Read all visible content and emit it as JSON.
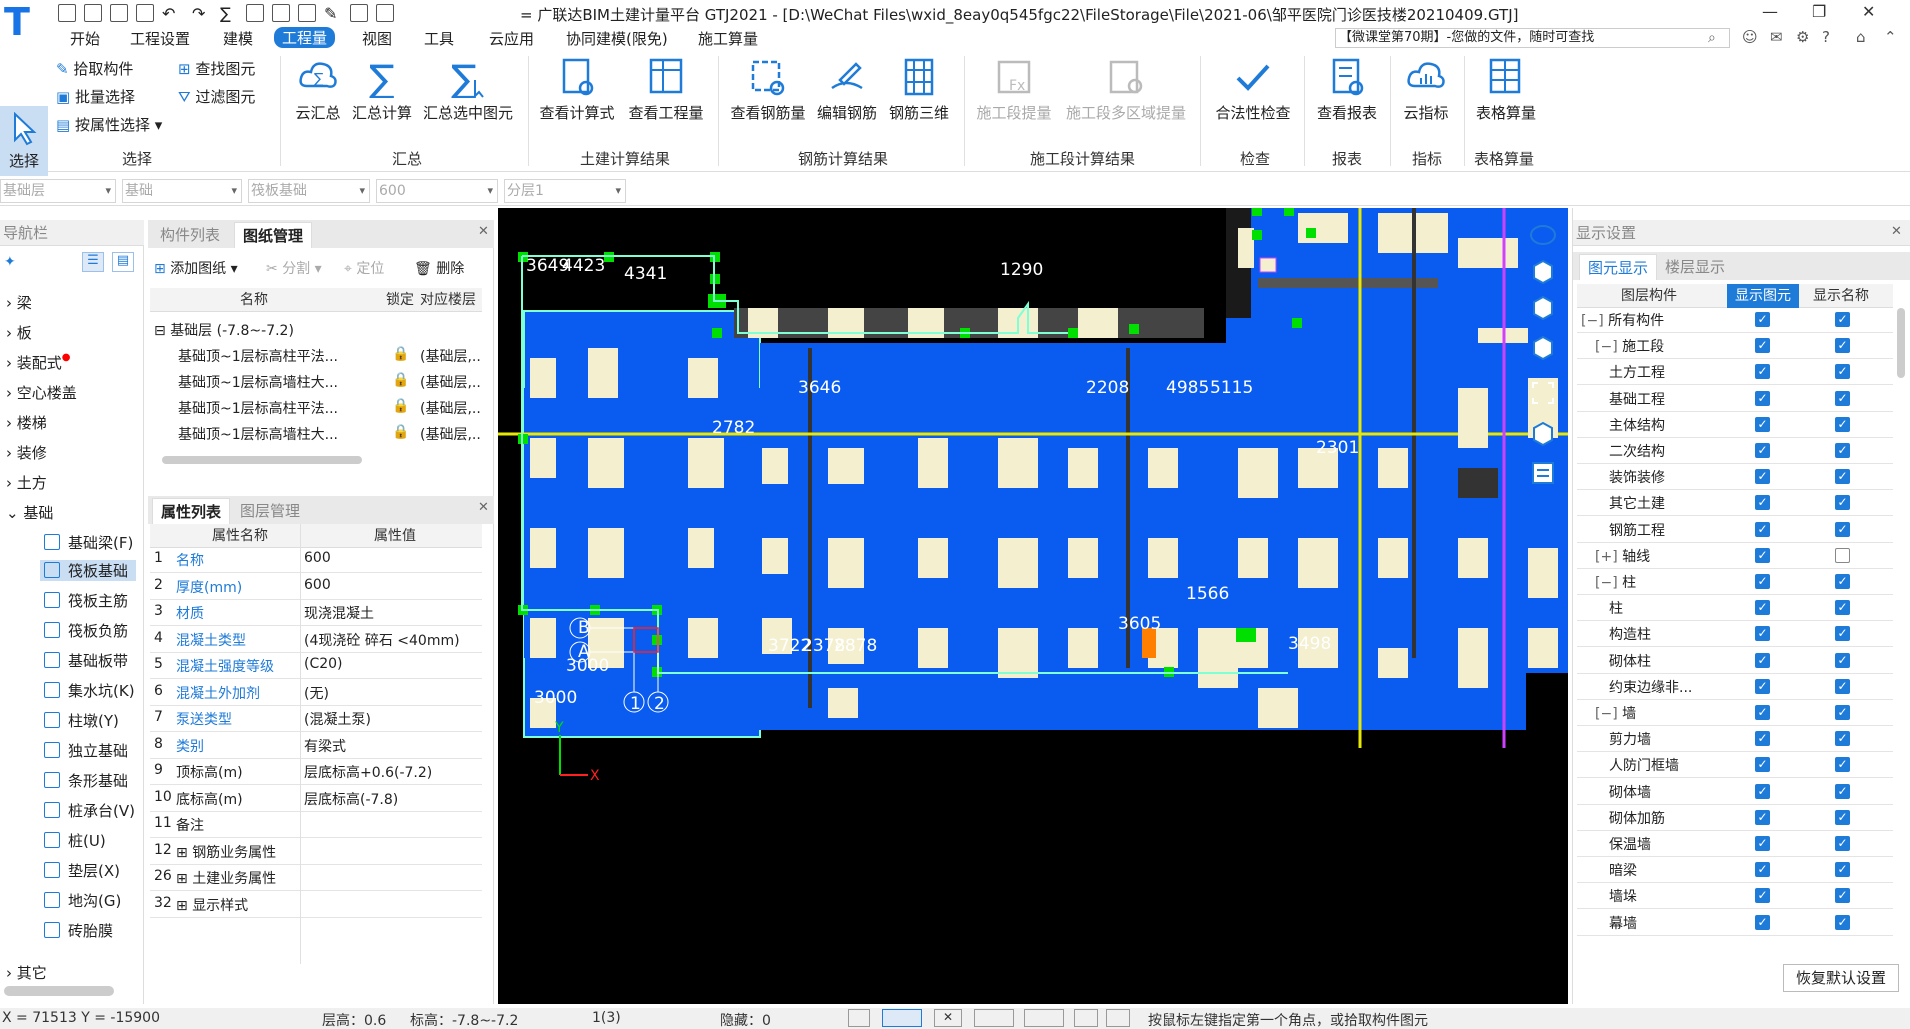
{
  "app": {
    "title": "= 广联达BIM土建计量平台 GTJ2021 - [D:\\WeChat Files\\wxid_8eay0q545fgc22\\FileStorage\\File\\2021-06\\邹平医院门诊医技楼20210409.GTJ]",
    "logo": "T"
  },
  "menu": [
    "开始",
    "工程设置",
    "建模",
    "工程量",
    "视图",
    "工具",
    "云应用",
    "协同建模(限免)",
    "施工算量"
  ],
  "menu_active": "工程量",
  "notice": "【微课堂第70期】-您做的文件，随时可查找",
  "ribbon": {
    "select": {
      "label": "选择",
      "items": [
        "拾取构件",
        "批量选择",
        "按属性选择",
        "查找图元",
        "过滤图元"
      ],
      "group": "选择"
    },
    "summary": {
      "items": [
        "云汇总",
        "汇总计算",
        "汇总选中图元"
      ],
      "group": "汇总"
    },
    "civil": {
      "items": [
        "查看计算式",
        "查看工程量"
      ],
      "group": "土建计算结果"
    },
    "rebar": {
      "items": [
        "查看钢筋量",
        "编辑钢筋",
        "钢筋三维"
      ],
      "group": "钢筋计算结果"
    },
    "stage": {
      "items": [
        "施工段提量",
        "施工段多区域提量"
      ],
      "group": "施工段计算结果"
    },
    "check": {
      "items": [
        "合法性检查"
      ],
      "group": "检查"
    },
    "report": {
      "items": [
        "查看报表"
      ],
      "group": "报表"
    },
    "index": {
      "items": [
        "云指标"
      ],
      "group": "指标"
    },
    "table": {
      "items": [
        "表格算量"
      ],
      "group": "表格算量"
    }
  },
  "filters": [
    "基础层",
    "基础",
    "筏板基础",
    "600",
    "分层1"
  ],
  "nav": {
    "title": "导航栏",
    "items": [
      "梁",
      "板",
      "装配式",
      "空心楼盖",
      "楼梯",
      "装修",
      "土方",
      "基础"
    ],
    "sub": [
      "基础梁(F)",
      "筏板基础",
      "筏板主筋",
      "筏板负筋",
      "基础板带",
      "集水坑(K)",
      "柱墩(Y)",
      "独立基础",
      "条形基础",
      "桩承台(V)",
      "桩(U)",
      "垫层(X)",
      "地沟(G)",
      "砖胎膜"
    ],
    "last": "其它"
  },
  "drawing_panel": {
    "tabs": [
      "构件列表",
      "图纸管理"
    ],
    "actions": [
      "添加图纸",
      "分割",
      "定位",
      "删除"
    ],
    "headers": [
      "名称",
      "锁定",
      "对应楼层"
    ],
    "group": "基础层 (-7.8~-7.2)",
    "rows": [
      {
        "name": "基础顶~1层标高柱平法...",
        "floor": "(基础层,..."
      },
      {
        "name": "基础顶~1层标高墙柱大...",
        "floor": "(基础层,..."
      },
      {
        "name": "基础顶~1层标高柱平法...",
        "floor": "(基础层,..."
      },
      {
        "name": "基础顶~1层标高墙柱大...",
        "floor": "(基础层,..."
      }
    ]
  },
  "prop_panel": {
    "tabs": [
      "属性列表",
      "图层管理"
    ],
    "headers": [
      "属性名称",
      "属性值"
    ],
    "rows": [
      {
        "n": "1",
        "name": "名称",
        "value": "600",
        "blue": true
      },
      {
        "n": "2",
        "name": "厚度(mm)",
        "value": "600",
        "blue": true
      },
      {
        "n": "3",
        "name": "材质",
        "value": "现浇混凝土",
        "blue": true
      },
      {
        "n": "4",
        "name": "混凝土类型",
        "value": "(4现浇砼 碎石 <40mm)",
        "blue": true
      },
      {
        "n": "5",
        "name": "混凝土强度等级",
        "value": "(C20)",
        "blue": true
      },
      {
        "n": "6",
        "name": "混凝土外加剂",
        "value": "(无)",
        "blue": true
      },
      {
        "n": "7",
        "name": "泵送类型",
        "value": "(混凝土泵)",
        "blue": true
      },
      {
        "n": "8",
        "name": "类别",
        "value": "有梁式",
        "blue": true
      },
      {
        "n": "9",
        "name": "顶标高(m)",
        "value": "层底标高+0.6(-7.2)",
        "blue": false
      },
      {
        "n": "10",
        "name": "底标高(m)",
        "value": "层底标高(-7.8)",
        "blue": false
      },
      {
        "n": "11",
        "name": "备注",
        "value": "",
        "blue": false
      },
      {
        "n": "12",
        "name": "钢筋业务属性",
        "value": "",
        "blue": false
      },
      {
        "n": "26",
        "name": "土建业务属性",
        "value": "",
        "blue": false
      },
      {
        "n": "32",
        "name": "显示样式",
        "value": "",
        "blue": false
      }
    ]
  },
  "canvas_labels": [
    "3649",
    "4423",
    "4341",
    "3646",
    "2782",
    "2378",
    "3000",
    "3000",
    "B",
    "A",
    "1",
    "2",
    "3498",
    "3605",
    "1566",
    "1290",
    "2208",
    "2301",
    "4985",
    "5115",
    "3722",
    "2878"
  ],
  "display": {
    "title": "显示设置",
    "tabs": [
      "图元显示",
      "楼层显示"
    ],
    "headers": [
      "图层构件",
      "显示图元",
      "显示名称"
    ],
    "rows": [
      {
        "name": "所有构件",
        "level": 0,
        "exp": "−",
        "a": true,
        "b": true
      },
      {
        "name": "施工段",
        "level": 1,
        "exp": "−",
        "a": true,
        "b": true
      },
      {
        "name": "土方工程",
        "level": 2,
        "exp": "",
        "a": true,
        "b": true
      },
      {
        "name": "基础工程",
        "level": 2,
        "exp": "",
        "a": true,
        "b": true
      },
      {
        "name": "主体结构",
        "level": 2,
        "exp": "",
        "a": true,
        "b": true
      },
      {
        "name": "二次结构",
        "level": 2,
        "exp": "",
        "a": true,
        "b": true
      },
      {
        "name": "装饰装修",
        "level": 2,
        "exp": "",
        "a": true,
        "b": true
      },
      {
        "name": "其它土建",
        "level": 2,
        "exp": "",
        "a": true,
        "b": true
      },
      {
        "name": "钢筋工程",
        "level": 2,
        "exp": "",
        "a": true,
        "b": true
      },
      {
        "name": "轴线",
        "level": 1,
        "exp": "+",
        "a": true,
        "b": false
      },
      {
        "name": "柱",
        "level": 1,
        "exp": "−",
        "a": true,
        "b": true
      },
      {
        "name": "柱",
        "level": 2,
        "exp": "",
        "a": true,
        "b": true
      },
      {
        "name": "构造柱",
        "level": 2,
        "exp": "",
        "a": true,
        "b": true
      },
      {
        "name": "砌体柱",
        "level": 2,
        "exp": "",
        "a": true,
        "b": true
      },
      {
        "name": "约束边缘非...",
        "level": 2,
        "exp": "",
        "a": true,
        "b": true
      },
      {
        "name": "墙",
        "level": 1,
        "exp": "−",
        "a": true,
        "b": true
      },
      {
        "name": "剪力墙",
        "level": 2,
        "exp": "",
        "a": true,
        "b": true
      },
      {
        "name": "人防门框墙",
        "level": 2,
        "exp": "",
        "a": true,
        "b": true
      },
      {
        "name": "砌体墙",
        "level": 2,
        "exp": "",
        "a": true,
        "b": true
      },
      {
        "name": "砌体加筋",
        "level": 2,
        "exp": "",
        "a": true,
        "b": true
      },
      {
        "name": "保温墙",
        "level": 2,
        "exp": "",
        "a": true,
        "b": true
      },
      {
        "name": "暗梁",
        "level": 2,
        "exp": "",
        "a": true,
        "b": true
      },
      {
        "name": "墙垛",
        "level": 2,
        "exp": "",
        "a": true,
        "b": true
      },
      {
        "name": "幕墙",
        "level": 2,
        "exp": "",
        "a": true,
        "b": true
      }
    ],
    "reset": "恢复默认设置"
  },
  "status": {
    "coords": "X = 71513 Y = -15900",
    "floor_h": "层高：0.6",
    "elev": "标高：-7.8~-7.2",
    "count": "1(3)",
    "hidden": "隐藏：0",
    "hint": "按鼠标左键指定第一个角点，或拾取构件图元"
  },
  "colors": {
    "accent": "#1f7bd8",
    "canvas_blue": "#0a5cf0",
    "green": "#00e000",
    "yellow": "#e8e800",
    "magenta": "#d040ff"
  }
}
